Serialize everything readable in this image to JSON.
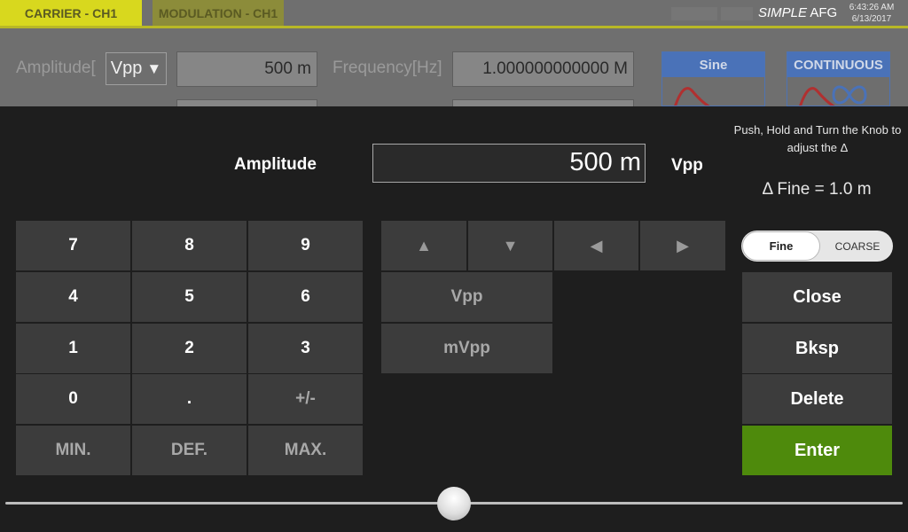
{
  "header": {
    "tabs": [
      {
        "label": "CARRIER - CH1",
        "active": true
      },
      {
        "label": "MODULATION - CH1",
        "active": false
      }
    ],
    "brand_italic": "SIMPLE",
    "brand_rest": "AFG",
    "time": "6:43:26 AM",
    "date": "6/13/2017"
  },
  "background": {
    "amplitude_label": "Amplitude[",
    "unit_select": "Vpp",
    "amplitude_value": "500 m",
    "frequency_label": "Frequency[Hz]",
    "frequency_value": "1.000000000000 M",
    "waveform": "Sine",
    "run_mode": "CONTINUOUS"
  },
  "keypad": {
    "title": "Amplitude",
    "value": "500 m",
    "unit": "Vpp",
    "hint": "Push, Hold and Turn the Knob to adjust the Δ",
    "delta": "Δ Fine = 1.0 m",
    "digits": [
      [
        "7",
        "8",
        "9"
      ],
      [
        "4",
        "5",
        "6"
      ],
      [
        "1",
        "2",
        "3"
      ],
      [
        "0",
        ".",
        "+/-"
      ]
    ],
    "presets": [
      "MIN.",
      "DEF.",
      "MAX."
    ],
    "arrows": {
      "up": "▲",
      "down": "▼",
      "left": "◀",
      "right": "▶"
    },
    "units": [
      "Vpp",
      "mVpp"
    ],
    "toggle": {
      "fine": "Fine",
      "coarse": "COARSE",
      "selected": "Fine"
    },
    "actions": {
      "close": "Close",
      "bksp": "Bksp",
      "delete": "Delete",
      "enter": "Enter"
    },
    "slider_position": 0.5
  },
  "colors": {
    "active_tab": "#d8d81e",
    "enter_button": "#4e8a0c",
    "waveform_header": "#4a72b8",
    "wave_trace": "#b03030"
  }
}
